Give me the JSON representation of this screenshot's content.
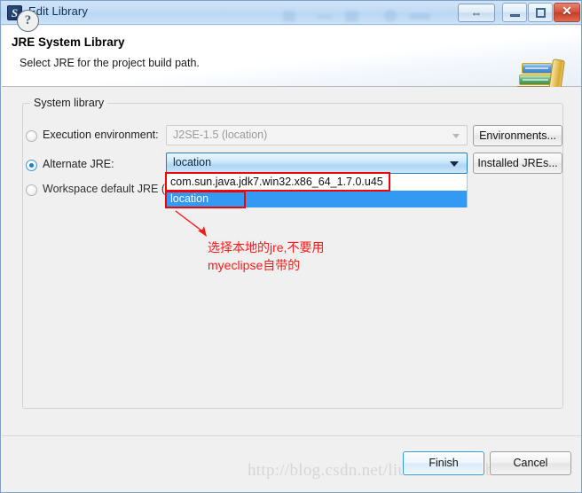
{
  "window": {
    "title": "Edit Library",
    "app_icon": "myeclipse-icon",
    "controls": {
      "restore_group_label": "⇔",
      "minimize_label": "minimize",
      "maximize_label": "maximize",
      "close_label": "✕"
    }
  },
  "banner": {
    "title": "JRE System Library",
    "subtitle": "Select JRE for the project build path.",
    "icon": "books-icon"
  },
  "form": {
    "group_title": "System library",
    "rows": [
      {
        "id": "execution-environment",
        "label": "Execution environment:",
        "selected": false,
        "combo_value": "J2SE-1.5 (location)",
        "combo_enabled": false,
        "button": "Environments..."
      },
      {
        "id": "alternate-jre",
        "label": "Alternate JRE:",
        "selected": true,
        "combo_value": "location",
        "combo_enabled": true,
        "button": "Installed JREs..."
      },
      {
        "id": "workspace-default-jre",
        "label": "Workspace default JRE (",
        "selected": false
      }
    ],
    "dropdown": {
      "open": true,
      "options": [
        "com.sun.java.jdk7.win32.x86_64_1.7.0.u45",
        "location"
      ],
      "highlighted_index": 1
    }
  },
  "annotation": {
    "line1": "选择本地的jre,不要用",
    "line2": "myeclipse自带的",
    "color": "#ff1a1a",
    "box_color": "#f20000"
  },
  "footer": {
    "help_label": "?",
    "finish_label": "Finish",
    "cancel_label": "Cancel",
    "watermark": "http://blog.csdn.net/liubin19911iubin"
  }
}
